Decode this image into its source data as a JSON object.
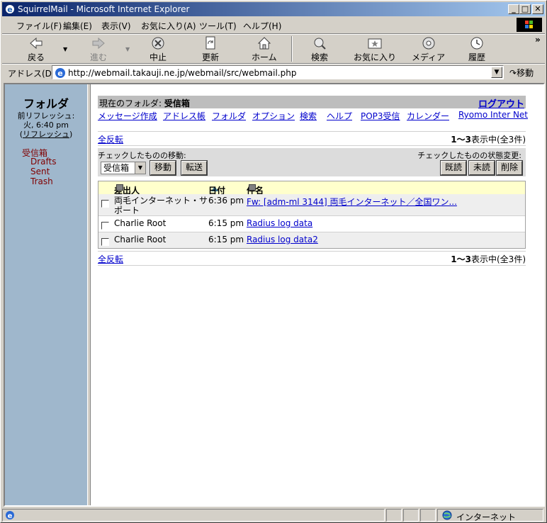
{
  "window": {
    "title": "SquirrelMail - Microsoft Internet Explorer",
    "minimize": "_",
    "maximize": "□",
    "close": "✕"
  },
  "menu": [
    "ファイル(F)",
    "編集(E)",
    "表示(V)",
    "お気に入り(A)",
    "ツール(T)",
    "ヘルプ(H)"
  ],
  "toolbar": {
    "back": "戻る",
    "forward": "進む",
    "stop": "中止",
    "refresh": "更新",
    "home": "ホーム",
    "search": "検索",
    "favorites": "お気に入り",
    "media": "メディア",
    "history": "履歴",
    "more": "»"
  },
  "address": {
    "label": "アドレス(D)",
    "url": "http://webmail.takauji.ne.jp/webmail/src/webmail.php",
    "go": "移動"
  },
  "sidebar": {
    "title": "フォルダ",
    "last_refresh": "前リフレッシュ:",
    "time": "火, 6:40 pm",
    "refresh_link": "リフレッシュ",
    "folders": [
      "受信箱",
      "Drafts",
      "Sent",
      "Trash"
    ]
  },
  "header": {
    "current_label": "現在のフォルダ: ",
    "current_folder": "受信箱",
    "logout": "ログアウト"
  },
  "nav": [
    "メッセージ作成",
    "アドレス帳",
    "フォルダ",
    "オプション",
    "検索",
    "ヘルプ",
    "POP3受信",
    "カレンダー",
    "Ryomo Inter Net"
  ],
  "list": {
    "toggle_all": "全反転",
    "count_range": "1～3",
    "count_text": "表示中(全3件)",
    "move_label": "チェックしたものの移動:",
    "status_label": "チェックしたものの状態変更:",
    "move_folder": "受信箱",
    "move_button": "移動",
    "forward_button": "転送",
    "read_button": "既読",
    "unread_button": "未読",
    "delete_button": "削除",
    "columns": {
      "from": "差出人",
      "date": "日付",
      "subject": "件名"
    },
    "messages": [
      {
        "from": "両毛インターネット・サポート",
        "date": "6:36 pm",
        "subject": "Fw: [adm-ml 3144] 両毛インターネット／全国ワン..."
      },
      {
        "from": "Charlie Root",
        "date": "6:15 pm",
        "subject": "Radius log data"
      },
      {
        "from": "Charlie Root",
        "date": "6:15 pm",
        "subject": "Radius log data2"
      }
    ]
  },
  "status": {
    "zone": "インターネット"
  }
}
